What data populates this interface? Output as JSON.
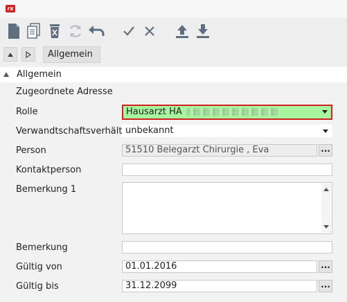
{
  "app": {
    "logo_text": "rx"
  },
  "toolbar": {
    "buttons": [
      "new-document",
      "copy-document",
      "delete",
      "refresh",
      "undo",
      "confirm",
      "cancel",
      "upload",
      "download"
    ]
  },
  "tabs": {
    "active": "Allgemein"
  },
  "section": {
    "title": "Allgemein",
    "subheading": "Zugeordnete Adresse"
  },
  "form": {
    "rolle": {
      "label": "Rolle",
      "value": "Hausarzt HA",
      "highlight_color": "#a8f5a0",
      "border_color": "#d21f1f"
    },
    "verwandtschaft": {
      "label": "Verwandtschaftsverhältn",
      "value": "unbekannt"
    },
    "person": {
      "label": "Person",
      "value": "51510 Belegarzt  Chirurgie , Eva"
    },
    "kontaktperson": {
      "label": "Kontaktperson",
      "value": ""
    },
    "bemerkung1": {
      "label": "Bemerkung 1",
      "value": ""
    },
    "bemerkung": {
      "label": "Bemerkung",
      "value": ""
    },
    "gueltig_von": {
      "label": "Gültig von",
      "value": "01.01.2016"
    },
    "gueltig_bis": {
      "label": "Gültig bis",
      "value": "31.12.2099"
    },
    "dots_label": "..."
  }
}
